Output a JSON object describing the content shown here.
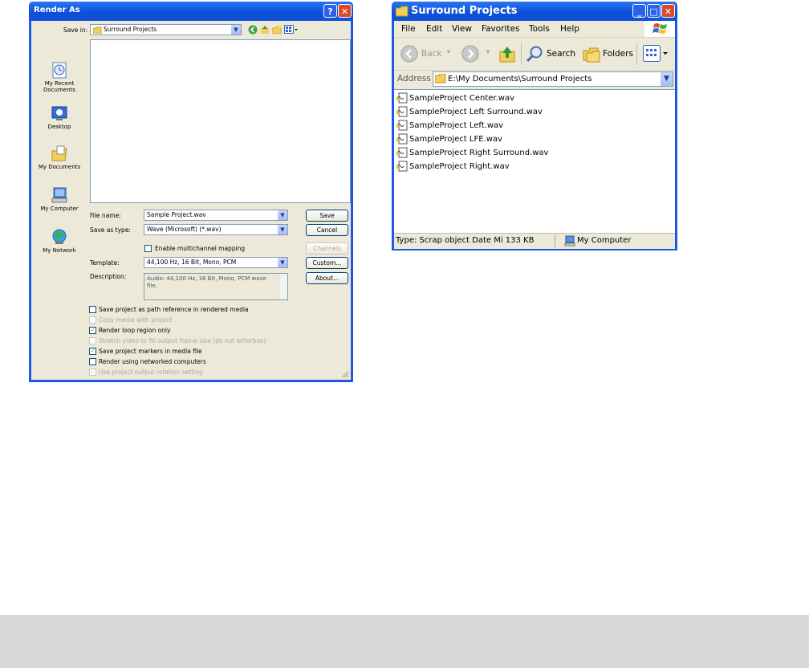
{
  "render_dialog": {
    "title": "Render As",
    "save_in_label": "Save in:",
    "save_in_value": "Surround Projects",
    "places": [
      "My Recent Documents",
      "Desktop",
      "My Documents",
      "My Computer",
      "My Network"
    ],
    "file_name_label": "File name:",
    "file_name_value": "Sample Project.wav",
    "save_as_type_label": "Save as type:",
    "save_as_type_value": "Wave (Microsoft) (*.wav)",
    "enable_multichannel_label": "Enable multichannel mapping",
    "template_label": "Template:",
    "template_value": "44,100 Hz, 16 Bit, Mono, PCM",
    "description_label": "Description:",
    "description_value": "Audio: 44,100 Hz, 16 Bit, Mono, PCM wave file.",
    "buttons": {
      "save": "Save",
      "cancel": "Cancel",
      "channels": "Channels",
      "custom": "Custom...",
      "about": "About..."
    },
    "options": [
      {
        "label": "Save project as path reference in rendered media",
        "checked": false,
        "enabled": true
      },
      {
        "label": "Copy media with project",
        "checked": false,
        "enabled": false
      },
      {
        "label": "Render loop region only",
        "checked": true,
        "enabled": true
      },
      {
        "label": "Stretch video to fill output frame size (do not letterbox)",
        "checked": false,
        "enabled": false
      },
      {
        "label": "Save project markers in media file",
        "checked": true,
        "enabled": true
      },
      {
        "label": "Render using networked computers",
        "checked": false,
        "enabled": true
      },
      {
        "label": "Use project output rotation setting",
        "checked": true,
        "enabled": false
      }
    ]
  },
  "explorer": {
    "title": "Surround Projects",
    "menu": [
      "File",
      "Edit",
      "View",
      "Favorites",
      "Tools",
      "Help"
    ],
    "toolbar": {
      "back": "Back",
      "search": "Search",
      "folders": "Folders"
    },
    "address_label": "Address",
    "address_value": "E:\\My Documents\\Surround Projects",
    "files": [
      "SampleProject Center.wav",
      "SampleProject Left Surround.wav",
      "SampleProject Left.wav",
      "SampleProject LFE.wav",
      "SampleProject Right Surround.wav",
      "SampleProject Right.wav"
    ],
    "status_left": "Type: Scrap object Date Mi 133 KB",
    "status_right": "My Computer"
  },
  "colors": {
    "xp_blue": "#0b4fd8",
    "dialog_bg": "#ece9d8",
    "field_border": "#7f9db9"
  }
}
